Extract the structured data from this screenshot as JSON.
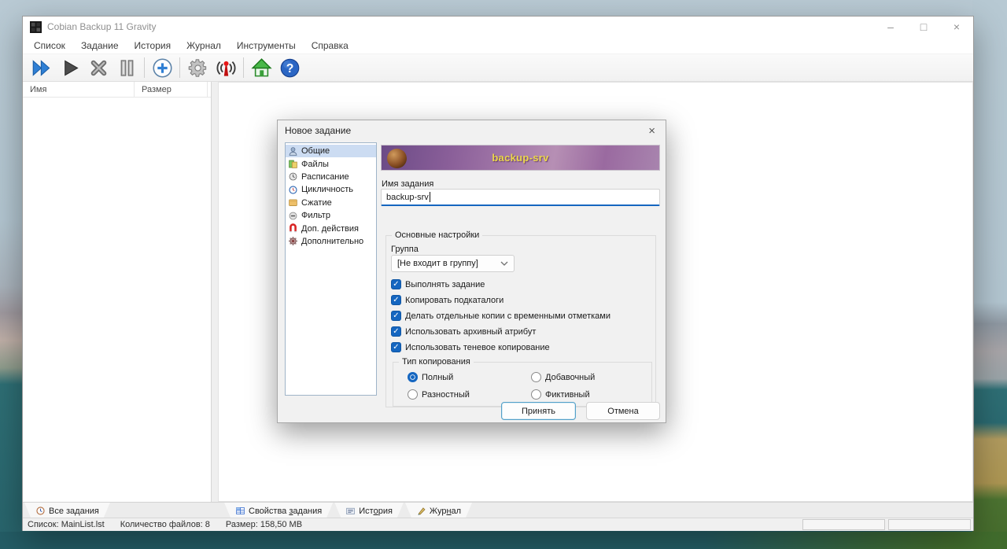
{
  "app": {
    "title": "Cobian Backup 11 Gravity",
    "menu": [
      "Список",
      "Задание",
      "История",
      "Журнал",
      "Инструменты",
      "Справка"
    ],
    "toolbar_icons": [
      "run-all",
      "run",
      "abort",
      "pause",
      "new-task",
      "settings",
      "remote",
      "home",
      "help"
    ],
    "window_controls": {
      "minimize": "–",
      "maximize": "□",
      "close": "×"
    },
    "list_columns": [
      "Имя",
      "Размер"
    ],
    "left_tab": {
      "label": "Все задания",
      "icon": "clock-icon"
    },
    "bottom_tabs": [
      {
        "pre": "Свойства ",
        "key": "з",
        "post": "адания",
        "icon": "grid-icon"
      },
      {
        "pre": "Ист",
        "key": "о",
        "post": "рия",
        "icon": "history-icon"
      },
      {
        "pre": "Жур",
        "key": "н",
        "post": "ал",
        "icon": "pen-icon"
      }
    ],
    "status": {
      "list": "Список: MainList.lst",
      "files": "Количество файлов: 8",
      "size": "Размер: 158,50 MB"
    }
  },
  "dialog": {
    "title": "Новое задание",
    "close": "×",
    "sidebar": [
      {
        "label": "Общие",
        "icon": "user-icon",
        "selected": true
      },
      {
        "label": "Файлы",
        "icon": "files-icon",
        "selected": false
      },
      {
        "label": "Расписание",
        "icon": "schedule-clock-icon",
        "selected": false
      },
      {
        "label": "Цикличность",
        "icon": "recurrence-icon",
        "selected": false
      },
      {
        "label": "Сжатие",
        "icon": "compression-folder-icon",
        "selected": false
      },
      {
        "label": "Фильтр",
        "icon": "filter-minus-icon",
        "selected": false
      },
      {
        "label": "Доп. действия",
        "icon": "magnet-icon",
        "selected": false
      },
      {
        "label": "Дополнительно",
        "icon": "advanced-gear-icon",
        "selected": false
      }
    ],
    "banner_text": "backup-srv",
    "name_label": "Имя задания",
    "name_value": "backup-srv",
    "main_group": {
      "legend": "Основные настройки",
      "group_label": "Группа",
      "group_value": "[Не входит в группу]",
      "checkboxes": [
        {
          "label": "Выполнять задание",
          "checked": true
        },
        {
          "label": "Копировать подкаталоги",
          "checked": true
        },
        {
          "label": "Делать отдельные копии с временными отметками",
          "checked": true
        },
        {
          "label": "Использовать архивный атрибут",
          "checked": true
        },
        {
          "label": "Использовать теневое копирование",
          "checked": true
        }
      ],
      "copy_type": {
        "legend": "Тип копирования",
        "options": [
          {
            "label": "Полный",
            "selected": true
          },
          {
            "label": "Добавочный",
            "selected": false
          },
          {
            "label": "Разностный",
            "selected": false
          },
          {
            "label": "Фиктивный",
            "selected": false
          }
        ]
      }
    },
    "ok_button": "Принять",
    "cancel_button": "Отмена"
  },
  "colors": {
    "accent_blue": "#1566c0",
    "banner_purple": "#8a5f99",
    "banner_text_yellow": "#ecd84a",
    "selected_item_bg": "#ccdcf2",
    "magnet_red": "#d82424",
    "home_green": "#2a8a2a"
  }
}
